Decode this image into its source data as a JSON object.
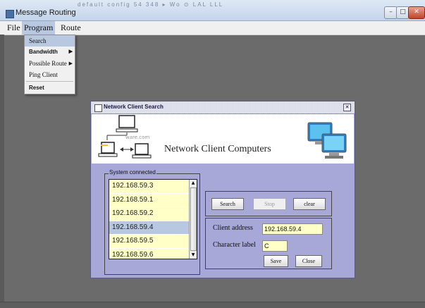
{
  "window": {
    "title": "Message Routing",
    "ghost_text": "default config  54  348  ▸  Wo  ⊙  LAL LLL  LL"
  },
  "menubar": {
    "items": [
      "File",
      "Program",
      "Route"
    ]
  },
  "program_menu": {
    "items": [
      {
        "label": "Search",
        "selected": true,
        "submenu": false
      },
      {
        "label": "Bandwidth",
        "selected": false,
        "submenu": true
      },
      {
        "label": "Possible Route",
        "selected": false,
        "submenu": true
      },
      {
        "label": "Ping Client",
        "selected": false,
        "submenu": false
      },
      {
        "label": "Reset",
        "selected": false,
        "submenu": false
      }
    ]
  },
  "dialog": {
    "title": "Network Client Search",
    "heading": "Network Client Computers",
    "logo_text": "ware.com",
    "group_label": "System connected",
    "clients": [
      "192.168.59.3",
      "192.168.59.1",
      "192.168.59.2",
      "192.168.59.4",
      "192.168.59.5",
      "192.168.59.6"
    ],
    "selected_client": "192.168.59.4",
    "buttons": {
      "search": "Search",
      "stop": "Stop",
      "clear": "clear",
      "save": "Save",
      "close": "Close"
    },
    "client_address_label": "Client address",
    "client_address_value": "192.168.59.4",
    "character_label_label": "Character label",
    "character_label_value": "C"
  }
}
